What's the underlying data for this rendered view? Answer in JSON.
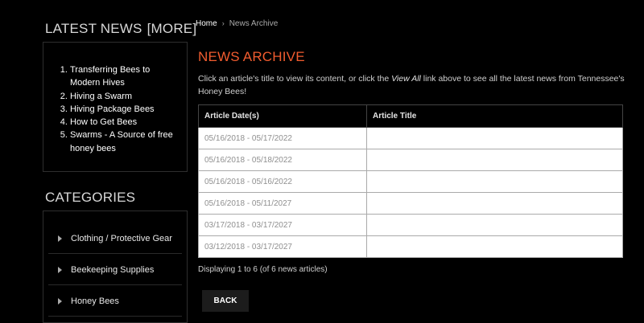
{
  "sidebar": {
    "latest_heading": "LATEST NEWS",
    "more_link": "[MORE]",
    "latest_items": [
      "Transferring Bees to Modern Hives",
      "Hiving a Swarm",
      "Hiving Package Bees",
      "How to Get Bees",
      "Swarms - A Source of free honey bees"
    ],
    "categories_heading": "CATEGORIES",
    "categories": [
      "Clothing / Protective Gear",
      "Beekeeping Supplies",
      "Honey Bees"
    ]
  },
  "breadcrumb": {
    "home": "Home",
    "separator": "›",
    "current": "News Archive"
  },
  "main": {
    "title": "NEWS ARCHIVE",
    "intro_before": "Click an article's title to view its content, or click the ",
    "intro_link": "View All",
    "intro_after": " link above to see all the latest news from Tennessee's Honey Bees!",
    "table": {
      "headers": [
        "Article Date(s)",
        "Article Title"
      ],
      "rows": [
        [
          "05/16/2018 - 05/17/2022",
          ""
        ],
        [
          "05/16/2018 - 05/18/2022",
          ""
        ],
        [
          "05/16/2018 - 05/16/2022",
          ""
        ],
        [
          "05/16/2018 - 05/11/2027",
          ""
        ],
        [
          "03/17/2018 - 03/17/2027",
          ""
        ],
        [
          "03/12/2018 - 03/17/2027",
          ""
        ]
      ]
    },
    "display_text": "Displaying 1 to 6 (of 6 news articles)",
    "back_label": "BACK"
  },
  "colors": {
    "accent": "#f25c2f",
    "background": "#000000"
  }
}
